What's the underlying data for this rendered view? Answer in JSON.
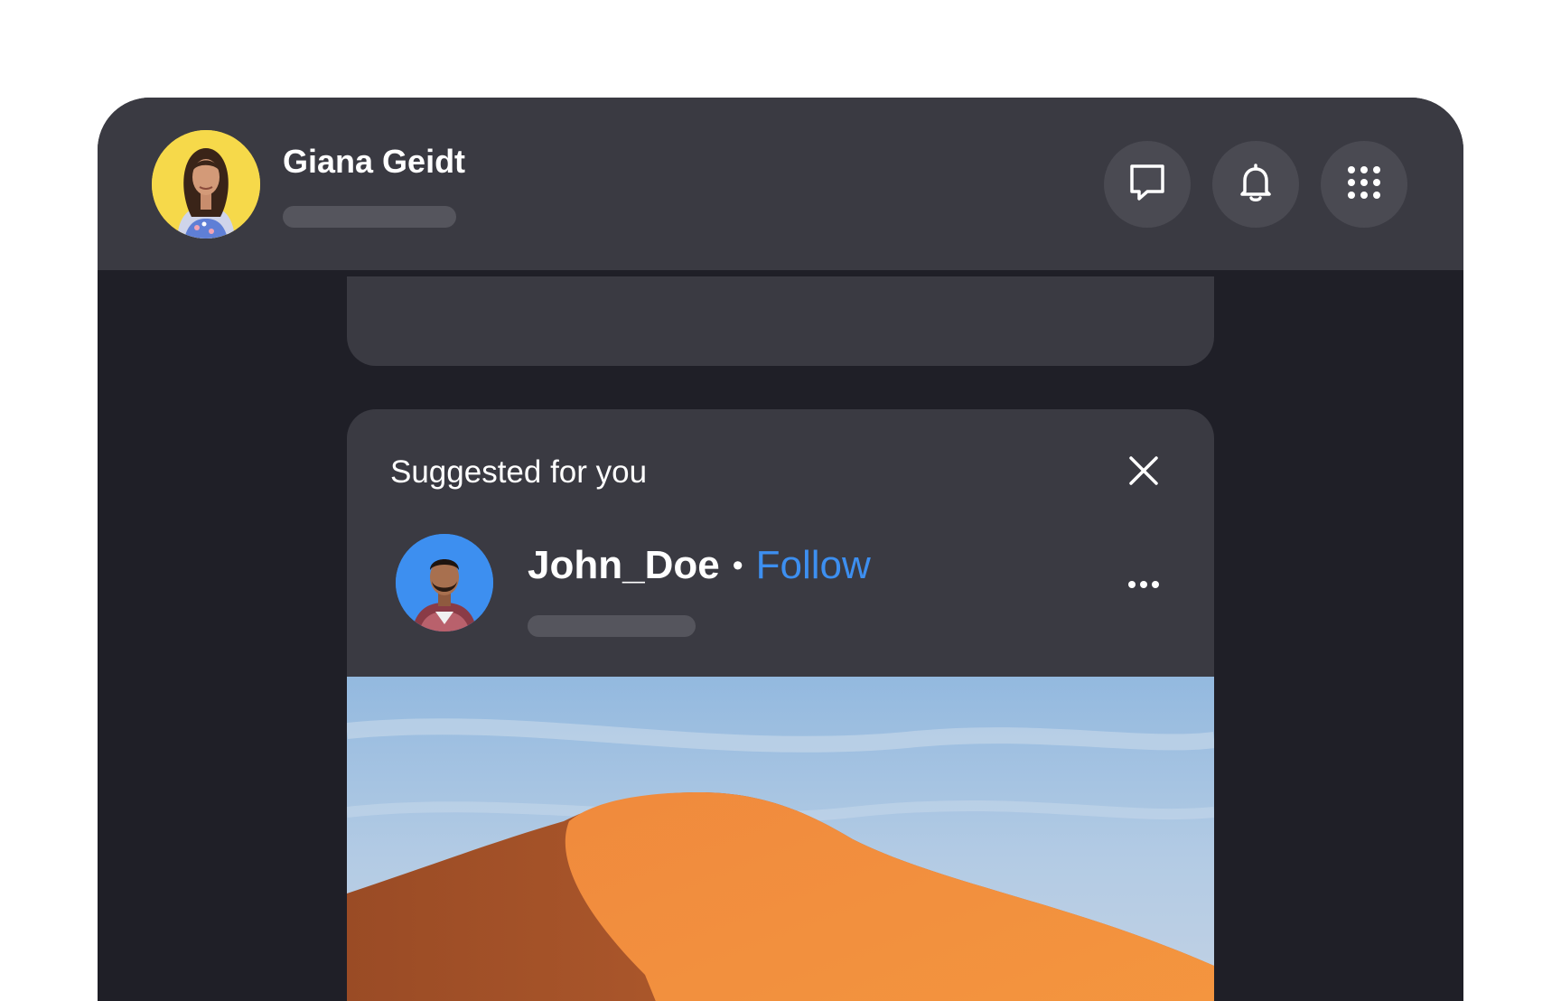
{
  "header": {
    "user_name": "Giana Geidt",
    "avatar_bg": "#f6d94a",
    "actions": [
      {
        "icon": "message-icon",
        "label": "Messages"
      },
      {
        "icon": "bell-icon",
        "label": "Notifications"
      },
      {
        "icon": "apps-grid-icon",
        "label": "Apps"
      }
    ]
  },
  "suggestion": {
    "title": "Suggested for you",
    "user": "John_Doe",
    "separator": "•",
    "follow_label": "Follow",
    "avatar_bg": "#3d8ff0",
    "icons": [
      "close-icon",
      "more-options-icon"
    ]
  },
  "post": {
    "image": "desert-dune-photo"
  },
  "colors": {
    "background": "#1f1f27",
    "panel": "#3a3a42",
    "accent": "#3d8ff0"
  }
}
